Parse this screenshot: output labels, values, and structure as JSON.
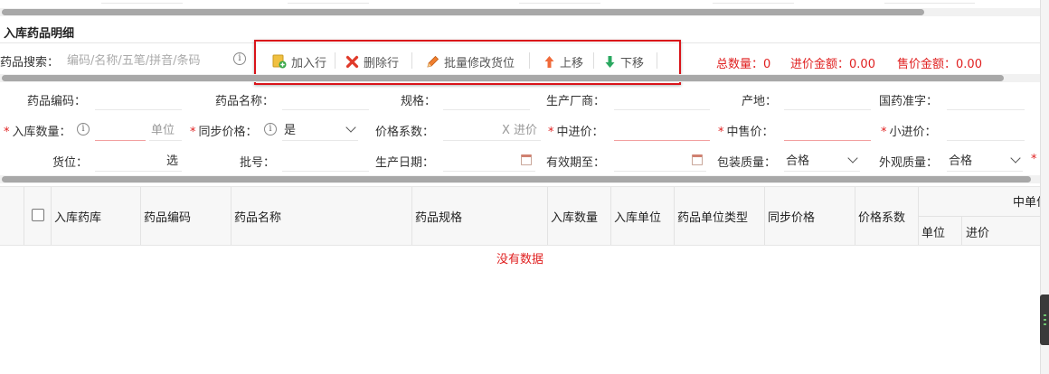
{
  "section": {
    "title": "入库药品明细"
  },
  "search": {
    "label": "药品搜索：",
    "placeholder": "编码/名称/五笔/拼音/条码"
  },
  "toolbar": {
    "add_row": "加入行",
    "delete_row": "删除行",
    "batch_edit_location": "批量修改货位",
    "move_up": "上移",
    "move_down": "下移"
  },
  "summary": {
    "total_qty_label": "总数量：",
    "total_qty_value": "0",
    "purchase_amount_label": "进价金额：",
    "purchase_amount_value": "0.00",
    "retail_amount_label": "售价金额：",
    "retail_amount_value": "0.00"
  },
  "form": {
    "drug_code_label": "药品编码：",
    "drug_name_label": "药品名称：",
    "spec_label": "规格：",
    "manufacturer_label": "生产厂商：",
    "origin_label": "产地：",
    "approval_label": "国药准字：",
    "in_qty_label": "入库数量：",
    "unit_placeholder": "单位",
    "sync_price_label": "同步价格：",
    "sync_price_value": "是",
    "price_coef_label": "价格系数：",
    "price_coef_suffix": "X 进价",
    "mid_purchase_label": "中进价：",
    "mid_retail_label": "中售价：",
    "small_purchase_label": "小进价：",
    "location_label": "货位：",
    "location_suffix": "选",
    "batch_label": "批号：",
    "prod_date_label": "生产日期：",
    "expiry_label": "有效期至：",
    "package_quality_label": "包装质量：",
    "package_quality_value": "合格",
    "appearance_quality_label": "外观质量：",
    "appearance_quality_value": "合格"
  },
  "table": {
    "columns": [
      "入库药库",
      "药品编码",
      "药品名称",
      "药品规格",
      "入库数量",
      "入库单位",
      "药品单位类型",
      "同步价格",
      "价格系数"
    ],
    "group_header": "中单位",
    "sub_columns": [
      "单位",
      "进价"
    ],
    "empty_text": "没有数据"
  },
  "colors": {
    "accent_red": "#e02020",
    "highlight_box": "#d9141a"
  },
  "icons": [
    "info-icon",
    "add-row-icon",
    "delete-icon",
    "pencil-icon",
    "arrow-up-icon",
    "arrow-down-icon",
    "chevron-down-icon",
    "calendar-icon"
  ]
}
